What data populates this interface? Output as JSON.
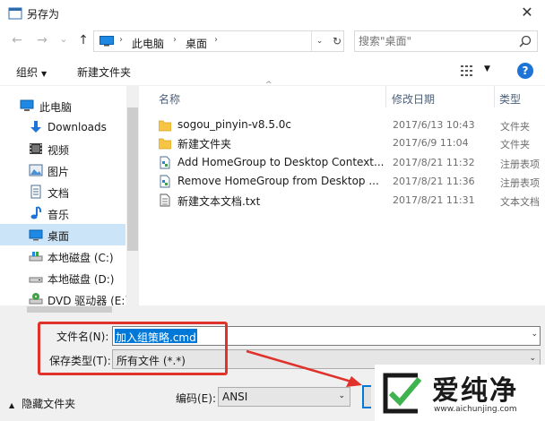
{
  "window": {
    "title": "另存为",
    "close_glyph": "✕"
  },
  "nav": {
    "back": "←",
    "forward": "→",
    "recent": "⌄",
    "up": "↑"
  },
  "address": {
    "crumbs": [
      "此电脑",
      "桌面"
    ],
    "separator": "›",
    "dropdown": "⌄",
    "refresh": "↻"
  },
  "search": {
    "placeholder": "搜索\"桌面\""
  },
  "toolbar": {
    "organize": "组织",
    "organize_caret": "▼",
    "new_folder": "新建文件夹",
    "view_caret": "▼",
    "help": "?"
  },
  "sidebar": {
    "items": [
      {
        "label": "此电脑",
        "icon": "pc-icon"
      },
      {
        "label": "Downloads",
        "icon": "download-icon"
      },
      {
        "label": "视频",
        "icon": "video-icon"
      },
      {
        "label": "图片",
        "icon": "picture-icon"
      },
      {
        "label": "文档",
        "icon": "document-icon"
      },
      {
        "label": "音乐",
        "icon": "music-icon"
      },
      {
        "label": "桌面",
        "icon": "desktop-icon",
        "selected": true
      },
      {
        "label": "本地磁盘 (C:)",
        "icon": "drive-icon"
      },
      {
        "label": "本地磁盘 (D:)",
        "icon": "drive-icon"
      },
      {
        "label": "DVD 驱动器 (E:)",
        "icon": "dvd-icon"
      }
    ]
  },
  "columns": {
    "name": "名称",
    "date": "修改日期",
    "type": "类型",
    "sort_caret": "^"
  },
  "files": [
    {
      "name": "sogou_pinyin-v8.5.0c",
      "date": "2017/6/13 10:43",
      "type": "文件夹",
      "icon": "folder-icon"
    },
    {
      "name": "新建文件夹",
      "date": "2017/6/9 11:04",
      "type": "文件夹",
      "icon": "folder-icon"
    },
    {
      "name": "Add HomeGroup to Desktop Context...",
      "date": "2017/8/21 11:32",
      "type": "注册表项",
      "icon": "registry-icon"
    },
    {
      "name": "Remove HomeGroup from Desktop ...",
      "date": "2017/8/21 11:36",
      "type": "注册表项",
      "icon": "registry-icon"
    },
    {
      "name": "新建文本文档.txt",
      "date": "2017/8/21 11:31",
      "type": "文本文档",
      "icon": "text-file-icon"
    }
  ],
  "save_form": {
    "filename_label": "文件名(N):",
    "filename_value": "加入组策略.cmd",
    "filetype_label": "保存类型(T):",
    "filetype_value": "所有文件 (*.*)",
    "dropdown": "⌄",
    "encoding_label": "编码(E):",
    "encoding_value": "ANSI",
    "hide_folders": "隐藏文件夹",
    "hide_caret": "▲"
  },
  "watermark": {
    "brand": "爱纯净",
    "url": "www.aichunjing.com"
  },
  "colors": {
    "selection": "#0078d7",
    "annotation_red": "#e0312a",
    "folder": "#f6c543"
  }
}
